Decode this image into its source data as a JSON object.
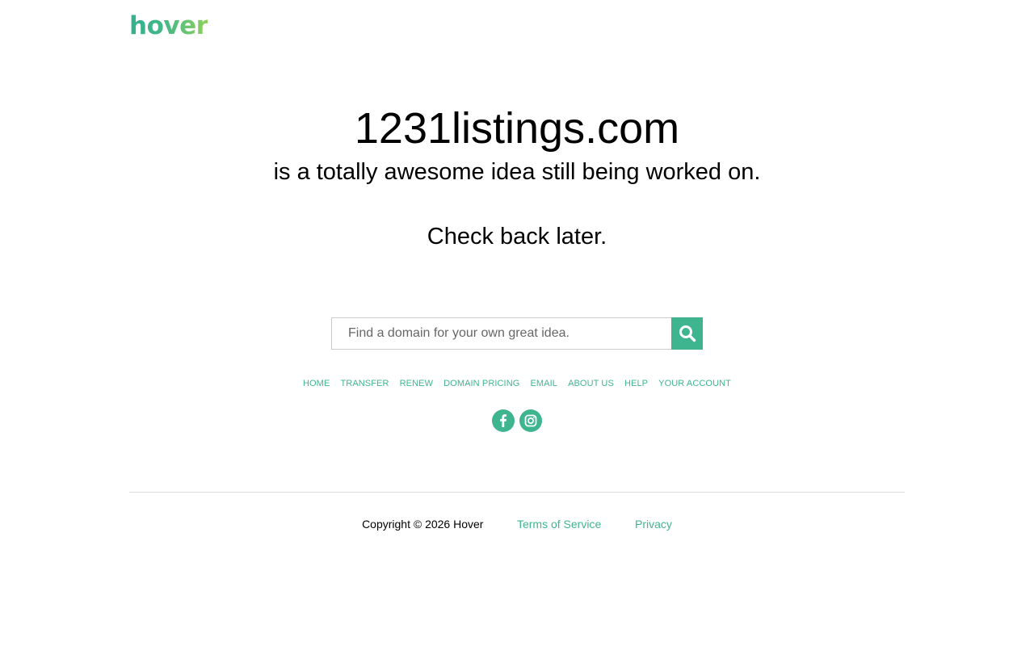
{
  "brand": {
    "logo_text": "hover",
    "accent_color": "#3fb58f"
  },
  "main": {
    "domain": "1231listings.com",
    "tagline": "is a totally awesome idea still being worked on.",
    "check_back": "Check back later."
  },
  "search": {
    "placeholder": "Find a domain for your own great idea.",
    "button_icon": "search-icon"
  },
  "nav": {
    "items": [
      {
        "label": "HOME"
      },
      {
        "label": "TRANSFER"
      },
      {
        "label": "RENEW"
      },
      {
        "label": "DOMAIN PRICING"
      },
      {
        "label": "EMAIL"
      },
      {
        "label": "ABOUT US"
      },
      {
        "label": "HELP"
      },
      {
        "label": "YOUR ACCOUNT"
      }
    ]
  },
  "social": {
    "icons": [
      "facebook-icon",
      "instagram-icon"
    ]
  },
  "footer": {
    "copyright": "Copyright © 2026 Hover",
    "terms": "Terms of Service",
    "privacy": "Privacy"
  }
}
